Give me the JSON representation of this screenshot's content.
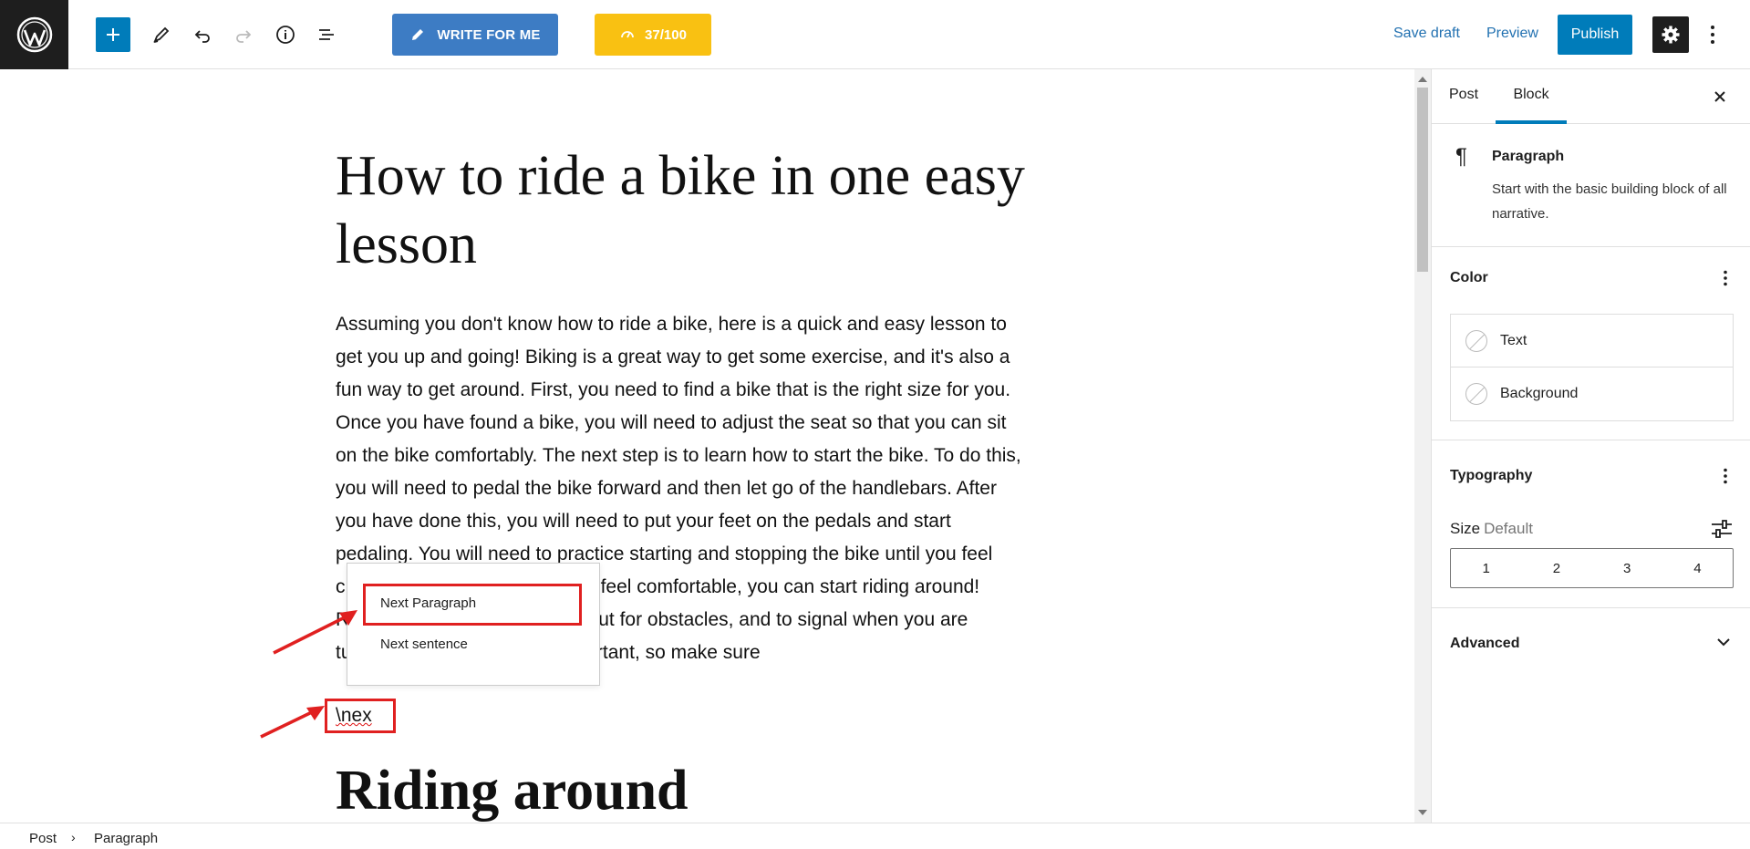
{
  "toolbar": {
    "write_label": "WRITE FOR ME",
    "score_label": "37/100",
    "save_draft": "Save draft",
    "preview": "Preview",
    "publish": "Publish"
  },
  "editor": {
    "title": "How to ride a bike in one easy lesson",
    "paragraph_lines": [
      "Assuming you don't know how to ride a bike, here is a quick and easy lesson to",
      "get you up and going! Biking is a great way to get some exercise, and it's also a",
      "fun way to get around. First, you need to find a bike that is the right size for you.",
      "Once you have found a bike, you will need to adjust the seat so that you can sit",
      "on the bike comfortably. The next step is to learn how to start the bike. To do this,",
      "you will need to pedal the bike forward and then let go of the handlebars. After",
      "you have done this, you will need to put your feet on the pedals and start",
      "pedaling. You will need to practice starting and stopping the bike until you feel",
      "c                                           ou feel comfortable, you can start riding around!",
      "R                                           kout for obstacles, and to signal when you are",
      "tu                                          portant, so make sure"
    ],
    "slash_input": "\\nex",
    "heading2": "Riding around",
    "popup": {
      "item_1": "Next Paragraph",
      "item_2": "Next sentence"
    }
  },
  "sidebar": {
    "tab_post": "Post",
    "tab_block": "Block",
    "block_name": "Paragraph",
    "block_description": "Start with the basic building block of all narrative.",
    "color_title": "Color",
    "color_text": "Text",
    "color_background": "Background",
    "typography_title": "Typography",
    "size_label": "Size",
    "size_value": "Default",
    "size_options": [
      "1",
      "2",
      "3",
      "4"
    ],
    "advanced_title": "Advanced"
  },
  "footer": {
    "crumb_post": "Post",
    "crumb_paragraph": "Paragraph"
  },
  "colors": {
    "wp_blue": "#007cba",
    "write_button": "#3d7cc4",
    "score_button": "#f9c112",
    "annotation_red": "#e02020",
    "dark": "#1e1e1e"
  }
}
